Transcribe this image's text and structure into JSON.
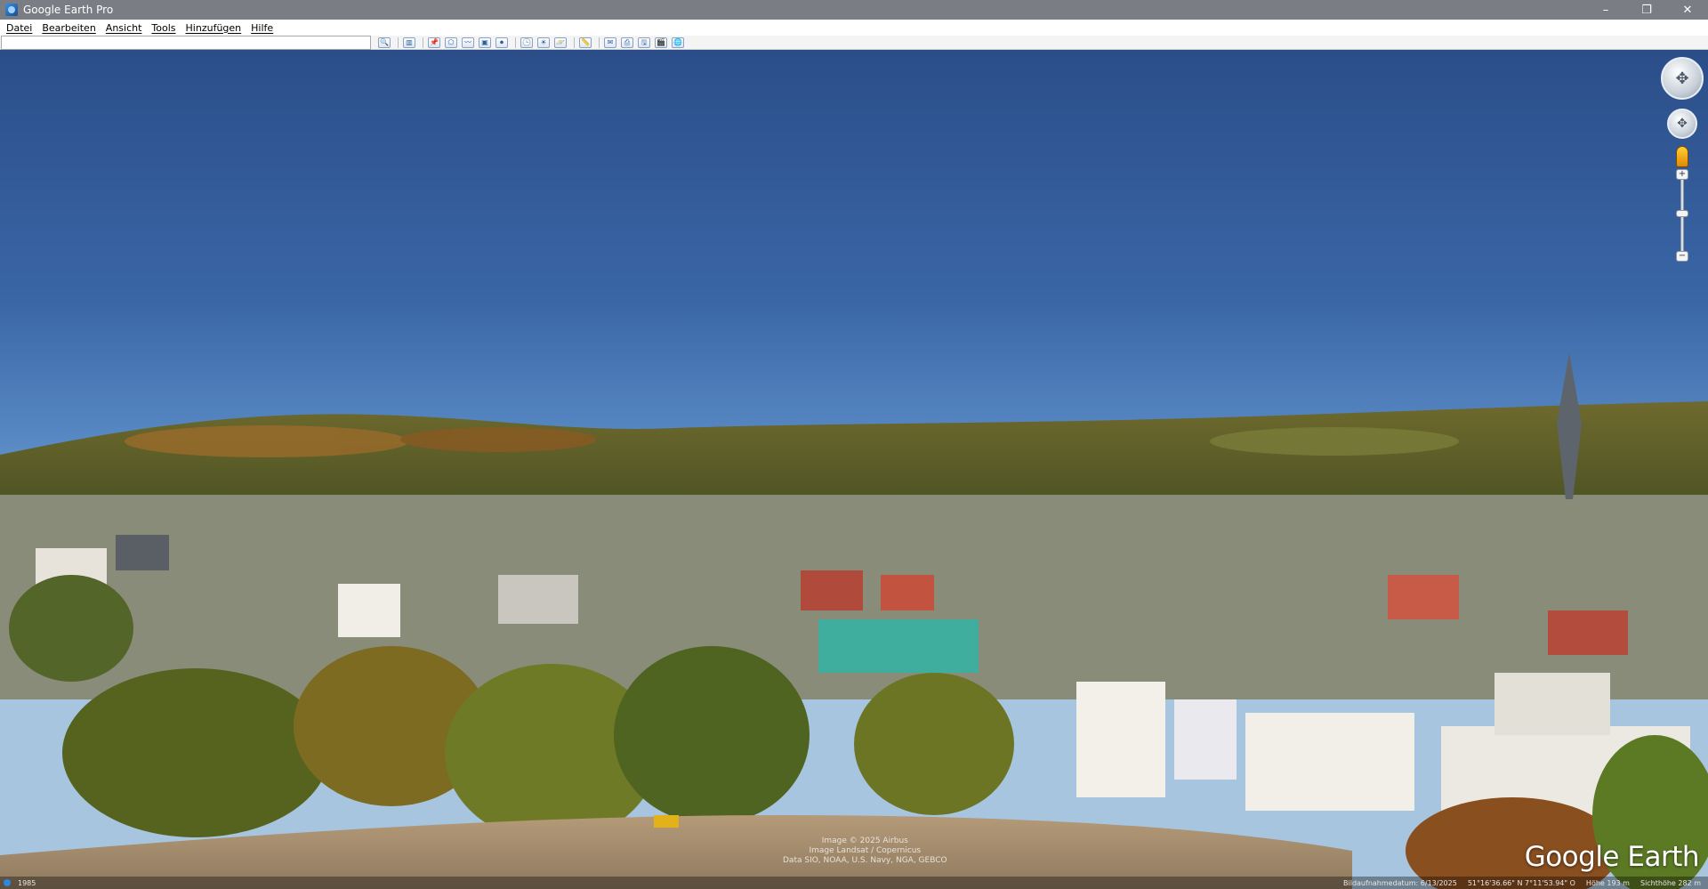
{
  "window": {
    "title": "Google Earth Pro",
    "controls": [
      "–",
      "❐",
      "✕"
    ]
  },
  "menu": [
    "Datei",
    "Bearbeiten",
    "Ansicht",
    "Tools",
    "Hinzufügen",
    "Hilfe"
  ],
  "toolbar": {
    "search_value": "",
    "buttons": [
      {
        "icon": "search-icon",
        "glyph": "🔍"
      },
      {
        "icon": "sidebar-icon",
        "glyph": "▥"
      },
      {
        "icon": "placemark-icon",
        "glyph": "📌"
      },
      {
        "icon": "polygon-icon",
        "glyph": "⬠"
      },
      {
        "icon": "path-icon",
        "glyph": "〰"
      },
      {
        "icon": "image-overlay-icon",
        "glyph": "▣"
      },
      {
        "icon": "tour-icon",
        "glyph": "⏺"
      },
      {
        "icon": "historical-imagery-icon",
        "glyph": "🕒"
      },
      {
        "icon": "sunlight-icon",
        "glyph": "☀"
      },
      {
        "icon": "planets-icon",
        "glyph": "🪐"
      },
      {
        "icon": "ruler-icon",
        "glyph": "📏"
      },
      {
        "icon": "email-icon",
        "glyph": "✉"
      },
      {
        "icon": "print-icon",
        "glyph": "⎙"
      },
      {
        "icon": "save-image-icon",
        "glyph": "🖫"
      },
      {
        "icon": "movie-icon",
        "glyph": "🎬"
      },
      {
        "icon": "google-maps-icon",
        "glyph": "🌐"
      }
    ]
  },
  "view": {
    "watermark": "Google Earth",
    "copyright_lines": [
      "Image © 2025 Airbus",
      "Image Landsat / Copernicus",
      "Data SIO, NOAA, U.S. Navy, NGA, GEBCO"
    ],
    "status": {
      "year": "1985",
      "imagery_date": "Bildaufnahmedatum: 6/13/2025",
      "coordinates": "51°16'36.66\" N   7°11'53.94\" O",
      "elevation": "Höhe 193 m",
      "eye_altitude": "Sichthöhe   282 m"
    }
  }
}
